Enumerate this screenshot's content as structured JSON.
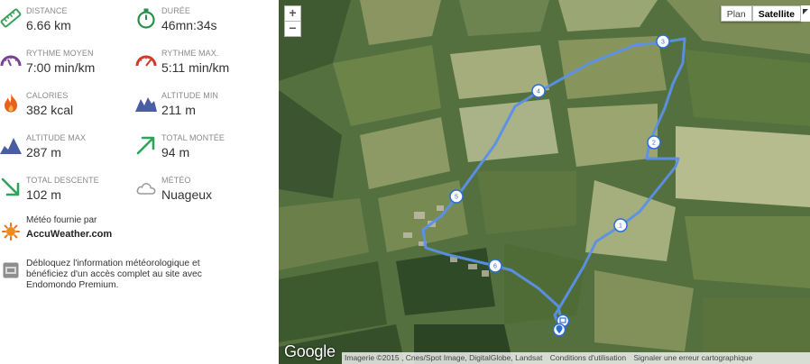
{
  "stats": [
    {
      "label": "DISTANCE",
      "value": "6.66 km",
      "icon": "ruler-icon"
    },
    {
      "label": "DURÉE",
      "value": "46mn:34s",
      "icon": "stopwatch-icon"
    },
    {
      "label": "RYTHME MOYEN",
      "value": "7:00 min/km",
      "icon": "gauge-icon"
    },
    {
      "label": "RYTHME MAX.",
      "value": "5:11 min/km",
      "icon": "gauge-max-icon"
    },
    {
      "label": "CALORIES",
      "value": "382 kcal",
      "icon": "flame-icon"
    },
    {
      "label": "ALTITUDE MIN",
      "value": "211 m",
      "icon": "mountain-low-icon"
    },
    {
      "label": "ALTITUDE MAX",
      "value": "287 m",
      "icon": "mountain-high-icon"
    },
    {
      "label": "TOTAL MONTÉE",
      "value": "94 m",
      "icon": "arrow-up-right-icon"
    },
    {
      "label": "TOTAL DESCENTE",
      "value": "102 m",
      "icon": "arrow-down-right-icon"
    },
    {
      "label": "MÉTÉO",
      "value": "Nuageux",
      "icon": "cloud-icon"
    }
  ],
  "weather_provider": {
    "text": "Météo fournie par",
    "name": "AccuWeather.com",
    "icon": "sun-icon"
  },
  "premium": {
    "text": "Débloquez l'information météorologique et bénéficiez d'un accès complet au site avec Endomondo Premium.",
    "icon": "premium-icon"
  },
  "map": {
    "zoom_in": "+",
    "zoom_out": "−",
    "type_plan": "Plan",
    "type_satellite": "Satellite",
    "logo": "Google",
    "attribution": "Imagerie ©2015 , Cnes/Spot Image, DigitalGlobe, Landsat",
    "terms": "Conditions d'utilisation",
    "report": "Signaler une erreur cartographique",
    "waypoints": [
      "1",
      "2",
      "3",
      "4",
      "5",
      "6"
    ],
    "route_color": "#4a86e8"
  }
}
